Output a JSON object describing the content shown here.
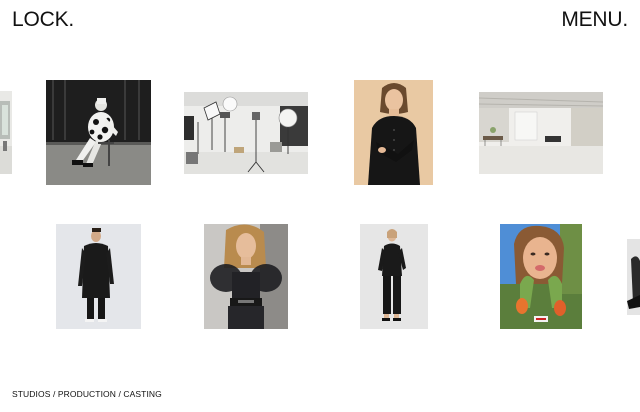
{
  "header": {
    "logo_text": "LOCK.",
    "menu_label": "MENU."
  },
  "footer": {
    "nav_text": "STUDIOS / PRODUCTION / CASTING"
  },
  "gallery": {
    "row1": [
      {
        "subject": "studio-interior-window-edge"
      },
      {
        "subject": "bw-portrait-seated-polka-dot"
      },
      {
        "subject": "photo-studio-lighting-setup"
      },
      {
        "subject": "portrait-woman-black-jacket"
      },
      {
        "subject": "empty-white-loft-studio"
      }
    ],
    "row2": [
      {
        "subject": "man-long-black-coat"
      },
      {
        "subject": "woman-sheer-black-top"
      },
      {
        "subject": "woman-black-jumpsuit"
      },
      {
        "subject": "girl-with-tulips"
      },
      {
        "subject": "bw-figure-edge"
      }
    ]
  }
}
